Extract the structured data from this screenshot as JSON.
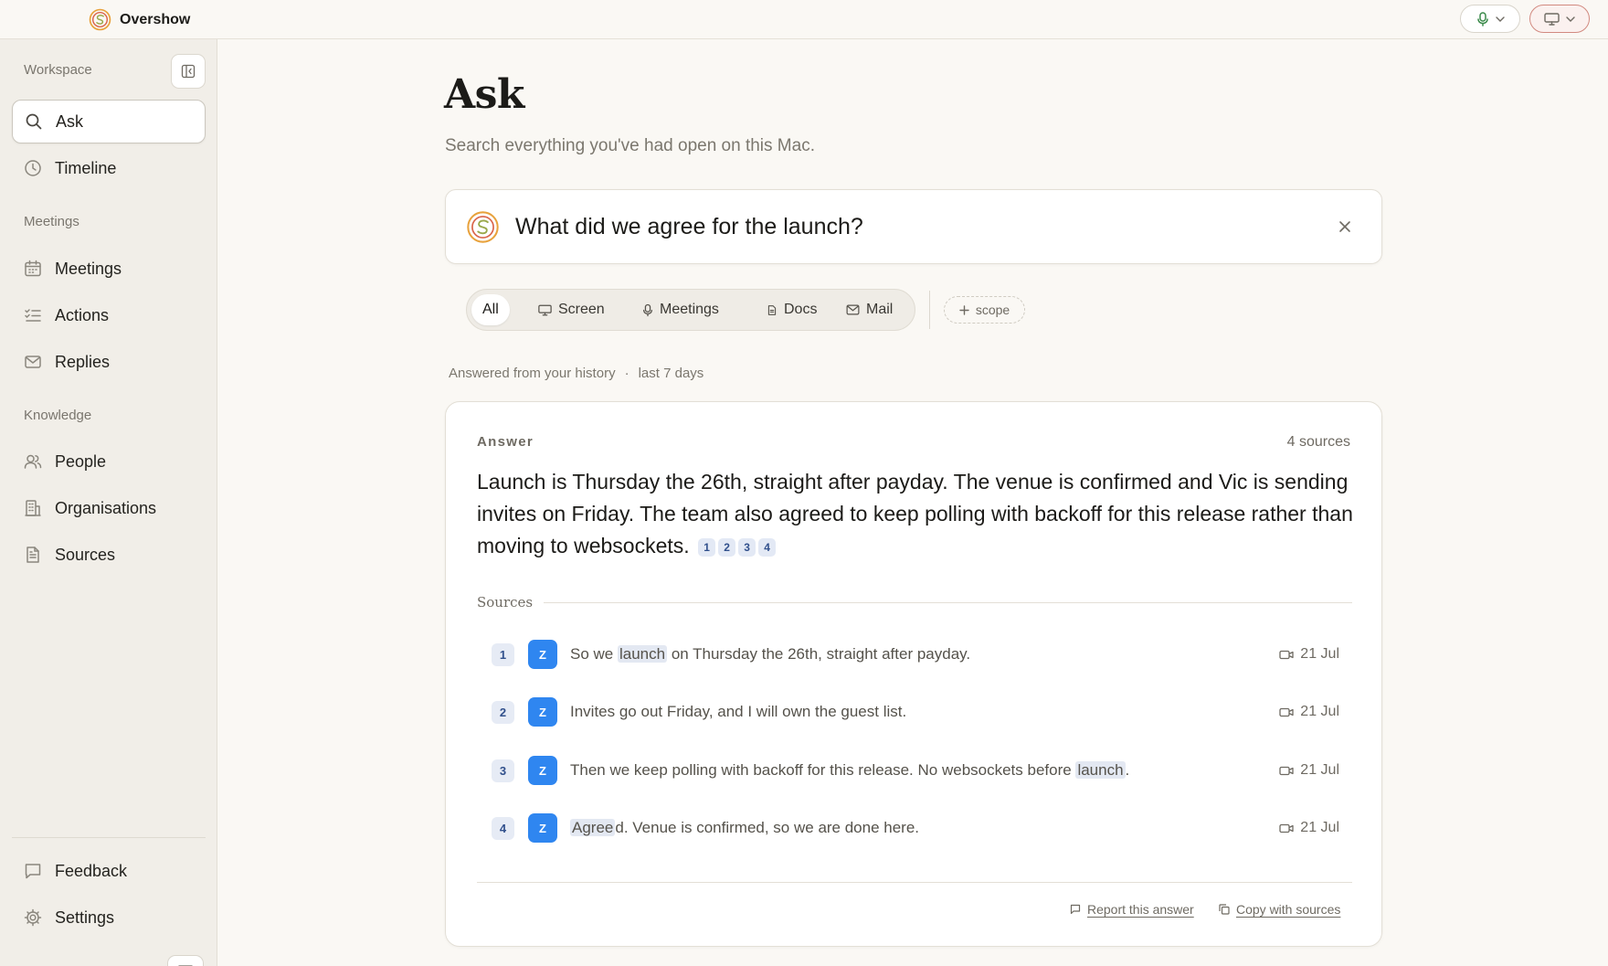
{
  "app": {
    "name": "Overshow"
  },
  "sidebar": {
    "sections": {
      "workspace": "Workspace",
      "meetings": "Meetings",
      "knowledge": "Knowledge"
    },
    "items": [
      {
        "label": "Ask",
        "icon": "search-icon",
        "active": true
      },
      {
        "label": "Timeline",
        "icon": "clock-icon"
      },
      {
        "label": "Meetings",
        "icon": "calendar-icon"
      },
      {
        "label": "Actions",
        "icon": "checklist-icon"
      },
      {
        "label": "Replies",
        "icon": "mail-icon"
      },
      {
        "label": "People",
        "icon": "people-icon"
      },
      {
        "label": "Organisations",
        "icon": "building-icon"
      },
      {
        "label": "Sources",
        "icon": "document-icon"
      },
      {
        "label": "Feedback",
        "icon": "message-icon"
      },
      {
        "label": "Settings",
        "icon": "gear-icon"
      }
    ]
  },
  "main": {
    "title": "Ask",
    "subtitle": "Search everything you've had open on this Mac.",
    "query": "What did we agree for the launch?",
    "filters": [
      {
        "label": "All",
        "active": true
      },
      {
        "label": "Screen",
        "icon": "monitor-icon"
      },
      {
        "label": "Meetings",
        "icon": "mic-icon"
      },
      {
        "label": "Docs",
        "icon": "doc-icon"
      },
      {
        "label": "Mail",
        "icon": "mail-icon"
      }
    ],
    "scope_label": "scope",
    "meta": {
      "source": "Answered from your history",
      "separator": "·",
      "range": "last 7 days"
    },
    "answer": {
      "label": "Answer",
      "sources_count": "4 sources",
      "text": "Launch is Thursday the 26th, straight after payday. The venue is confirmed and Vic is sending invites on Friday. The team also agreed to keep polling with backoff for this release rather than moving to websockets.",
      "citations": [
        "1",
        "2",
        "3",
        "4"
      ]
    },
    "sources_label": "Sources",
    "sources": [
      {
        "num": "1",
        "avatar": "Z",
        "pre": "So we ",
        "highlight": "launch",
        "post": " on Thursday the 26th, straight after payday.",
        "date": "21 Jul"
      },
      {
        "num": "2",
        "avatar": "Z",
        "pre": "Invites go out Friday, and I will own the guest list.",
        "highlight": "",
        "post": "",
        "date": "21 Jul"
      },
      {
        "num": "3",
        "avatar": "Z",
        "pre": "Then we keep polling with backoff for this release. No websockets before ",
        "highlight": "launch",
        "post": ".",
        "date": "21 Jul"
      },
      {
        "num": "4",
        "avatar": "Z",
        "pre": "",
        "highlight": "Agree",
        "post": "d. Venue is confirmed, so we are done here.",
        "date": "21 Jul"
      }
    ],
    "actions": {
      "report": "Report this answer",
      "copy": "Copy with sources"
    }
  },
  "colors": {
    "accent_blue": "#2f86f0",
    "record_red": "#d28a80",
    "mic_green": "#3a8a4a",
    "background": "#faf8f4"
  }
}
